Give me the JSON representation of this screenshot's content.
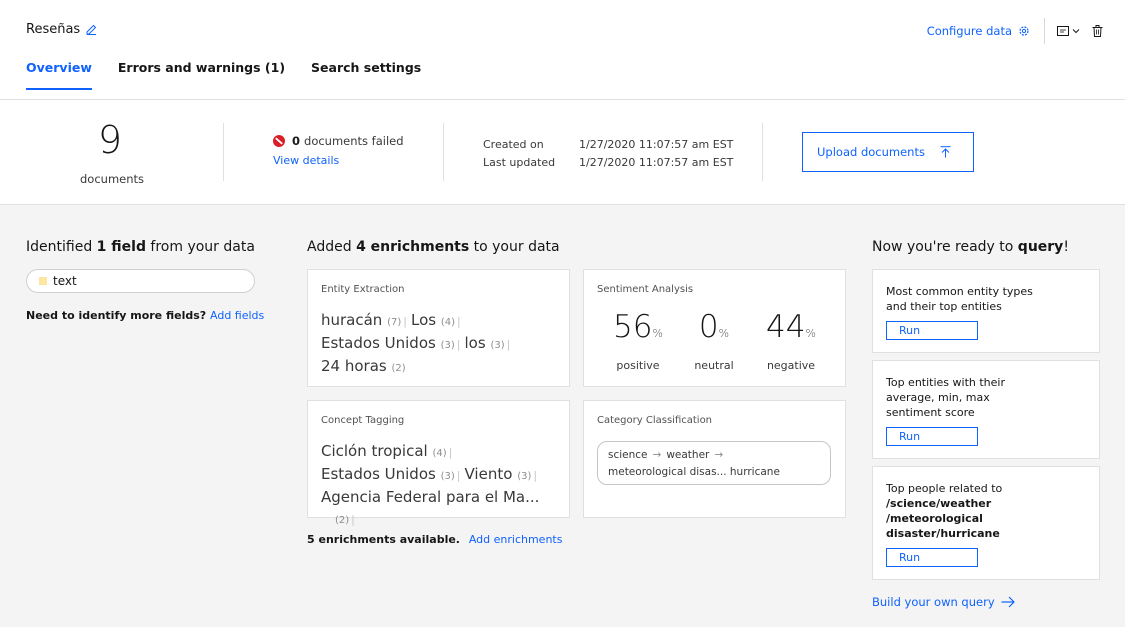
{
  "header": {
    "title": "Reseñas",
    "configure_label": "Configure data",
    "tabs": [
      {
        "label": "Overview",
        "active": true
      },
      {
        "label": "Errors and warnings (1)",
        "active": false
      },
      {
        "label": "Search settings",
        "active": false
      }
    ]
  },
  "stats": {
    "documents_count": "9",
    "documents_label": "documents",
    "failed_count": "0",
    "failed_label": "documents failed",
    "view_details": "View details",
    "created_label": "Created on",
    "created_value": "1/27/2020 11:07:57 am EST",
    "updated_label": "Last updated",
    "updated_value": "1/27/2020 11:07:57 am EST",
    "upload_label": "Upload documents"
  },
  "fields": {
    "title_pre": "Identified ",
    "title_bold": "1 field",
    "title_post": " from your data",
    "field_name": "text",
    "need_more": "Need to identify more fields?",
    "add_fields": "Add fields"
  },
  "enrichments": {
    "title_pre": "Added ",
    "title_bold": "4 enrichments",
    "title_post": " to your data",
    "entity": {
      "title": "Entity Extraction",
      "lines": [
        [
          {
            "t": "huracán",
            "n": "(7)"
          },
          {
            "t": "Los",
            "n": "(4)"
          }
        ],
        [
          {
            "t": "Estados Unidos",
            "n": "(3)"
          },
          {
            "t": "los",
            "n": "(3)"
          }
        ],
        [
          {
            "t": "24 horas",
            "n": "(2)"
          }
        ]
      ]
    },
    "sentiment": {
      "title": "Sentiment Analysis",
      "items": [
        {
          "value": "56",
          "unit": "%",
          "label": "positive"
        },
        {
          "value": "0",
          "unit": "%",
          "label": "neutral"
        },
        {
          "value": "44",
          "unit": "%",
          "label": "negative"
        }
      ]
    },
    "concept": {
      "title": "Concept Tagging",
      "lines": [
        [
          {
            "t": "Ciclón tropical",
            "n": "(4)"
          }
        ],
        [
          {
            "t": "Estados Unidos",
            "n": "(3)"
          },
          {
            "t": "Viento",
            "n": "(3)"
          }
        ],
        [
          {
            "t": "Agencia Federal para el Ma...",
            "n": "(2)"
          }
        ]
      ]
    },
    "category": {
      "title": "Category Classification",
      "path1": "science",
      "path2": "weather",
      "path3": "meteorological disas...",
      "path4": "hurricane"
    },
    "available": "5 enrichments available.",
    "add_enrichments": "Add enrichments"
  },
  "query": {
    "title_pre": "Now you're ready to ",
    "title_bold": "query",
    "title_post": "!",
    "cards": [
      {
        "text": "Most common entity types and their top entities",
        "run": "Run"
      },
      {
        "text": "Top entities with their average, min, max sentiment score",
        "run": "Run"
      },
      {
        "text_pre": "Top people related to",
        "text_bold": "/science/weather /meteorological disaster/hurricane",
        "run": "Run"
      }
    ],
    "build_own": "Build your own query"
  }
}
